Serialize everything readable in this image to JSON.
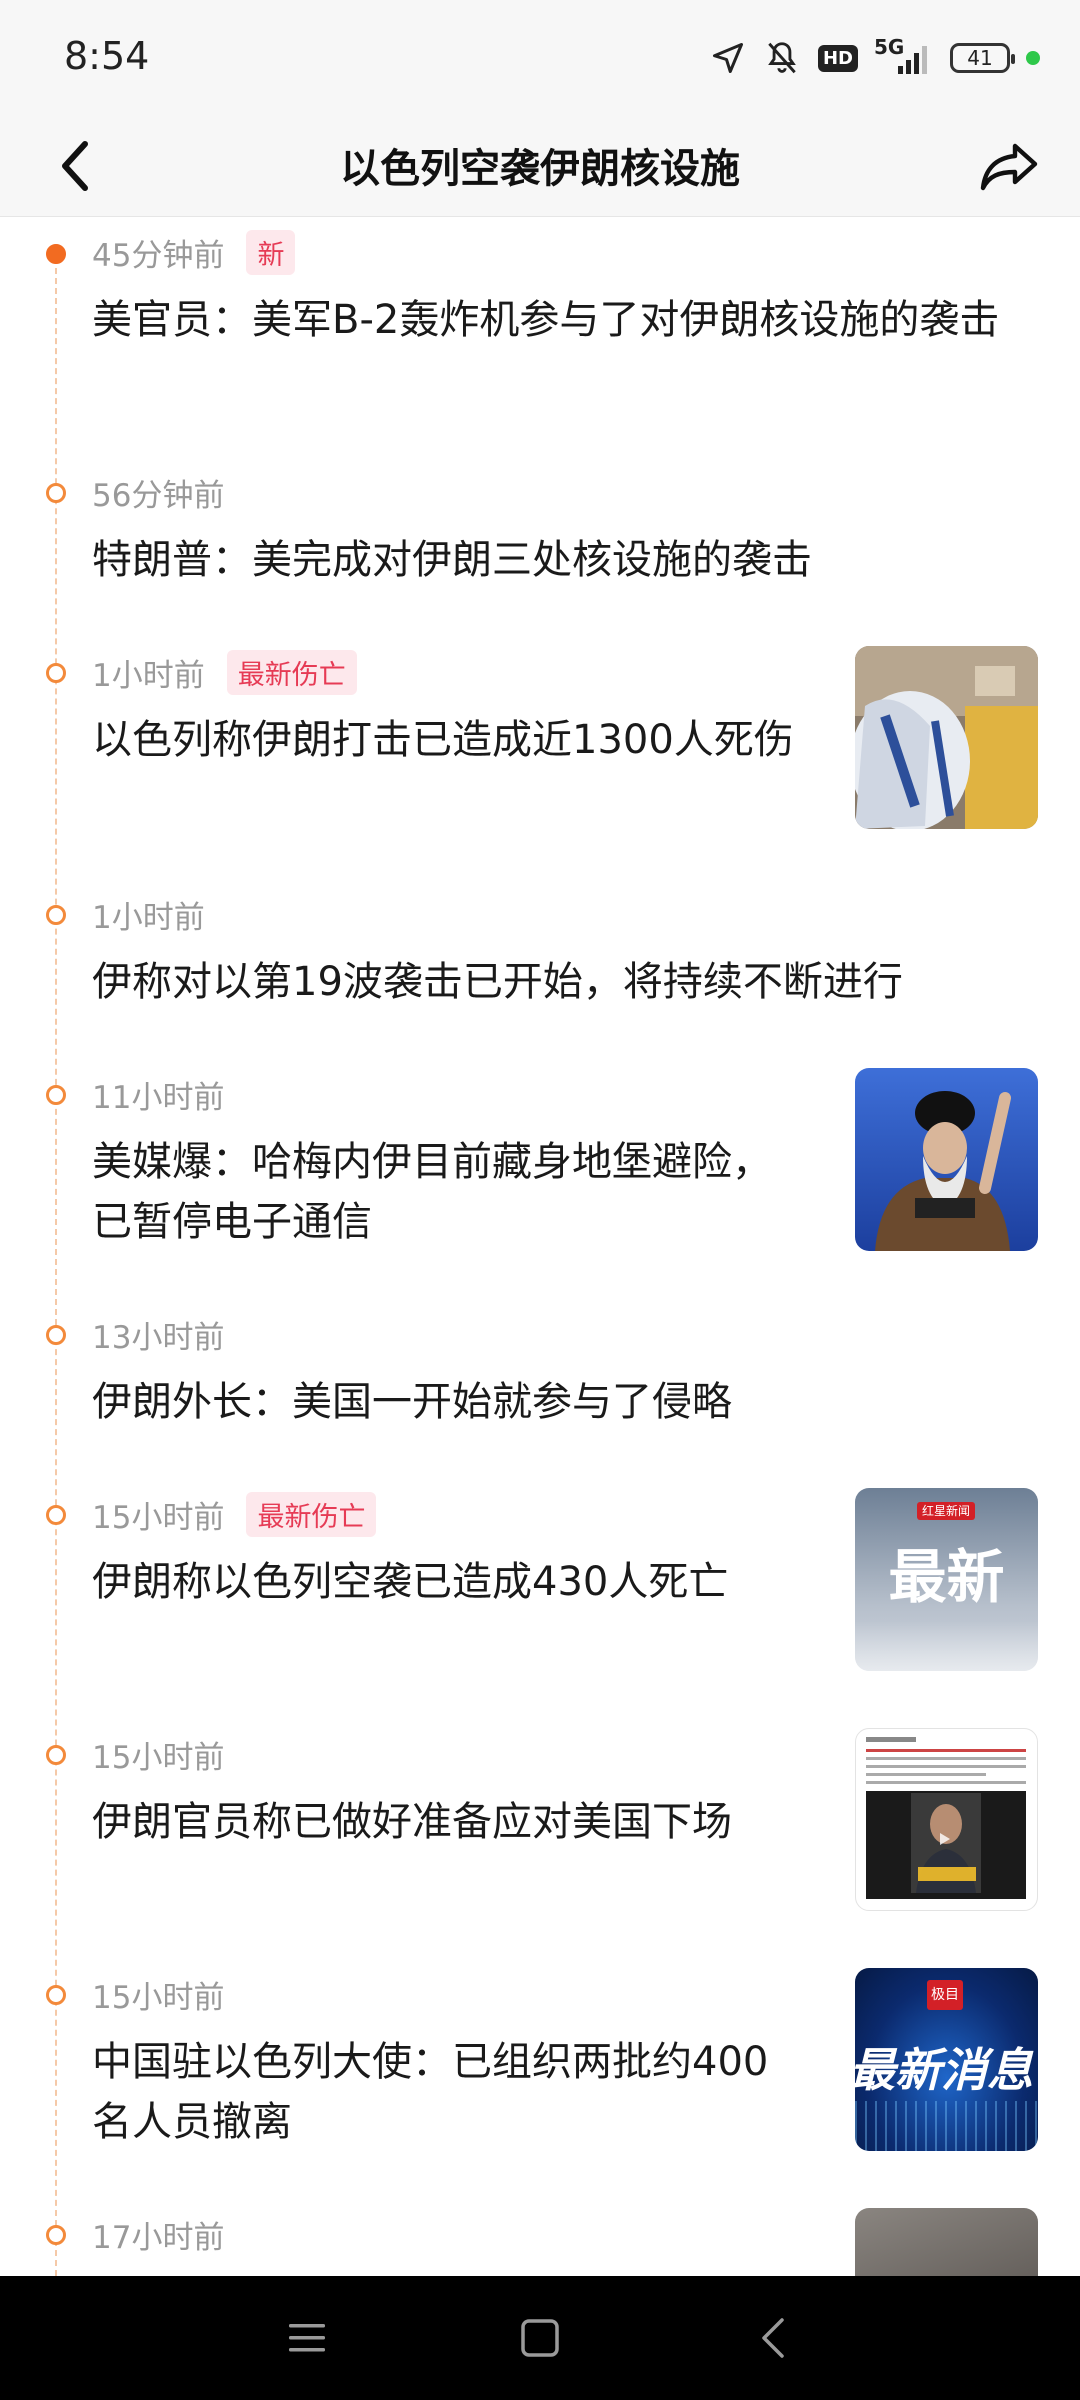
{
  "status_bar": {
    "time": "8:54",
    "hd": "HD",
    "net_5g": "5G",
    "battery": "41",
    "icons": [
      "location-icon",
      "mute-icon",
      "hd-icon",
      "signal-icon",
      "battery-icon",
      "privacy-indicator"
    ]
  },
  "header": {
    "title": "以色列空袭伊朗核设施",
    "back_icon": "chevron-left-icon",
    "share_icon": "share-arrow-icon"
  },
  "feed": {
    "items": [
      {
        "time": "45分钟前",
        "tag": "新",
        "headline": "美官员：美军B-2轰炸机参与了对伊朗核设施的袭击"
      },
      {
        "time": "56分钟前",
        "tag": "",
        "headline": "特朗普：美完成对伊朗三处核设施的袭击"
      },
      {
        "time": "1小时前",
        "tag": "最新伤亡",
        "headline": "以色列称伊朗打击已造成近1300人死伤",
        "thumb": "photo"
      },
      {
        "time": "1小时前",
        "tag": "",
        "headline": "伊称对以第19波袭击已开始，将持续不断进行"
      },
      {
        "time": "11小时前",
        "tag": "",
        "headline": "美媒爆：哈梅内伊目前藏身地堡避险，已暂停电子通信",
        "thumb": "photo"
      },
      {
        "time": "13小时前",
        "tag": "",
        "headline": "伊朗外长：美国一开始就参与了侵略"
      },
      {
        "time": "15小时前",
        "tag": "最新伤亡",
        "headline": "伊朗称以色列空袭已造成430人死亡",
        "thumb": "graphic",
        "thumb_text": "最新",
        "thumb_badge": "红星新闻"
      },
      {
        "time": "15小时前",
        "tag": "",
        "headline": "伊朗官员称已做好准备应对美国下场",
        "thumb": "screenshot",
        "thumb_caption": "伊朗官员称已做好准备应对美国下场"
      },
      {
        "time": "15小时前",
        "tag": "",
        "headline": "中国驻以色列大使：已组织两批约400名人员撤离",
        "thumb": "graphic",
        "thumb_text": "最新消息",
        "thumb_badge": "极目"
      },
      {
        "time": "17小时前",
        "tag": "",
        "headline": "",
        "thumb": "photo"
      }
    ]
  },
  "nav_bar": {
    "buttons": [
      "menu-icon",
      "home-icon",
      "back-icon"
    ]
  },
  "colors": {
    "accent_orange": "#f26b21",
    "tag_red": "#e63b55",
    "tag_bg": "#fde8ec"
  }
}
